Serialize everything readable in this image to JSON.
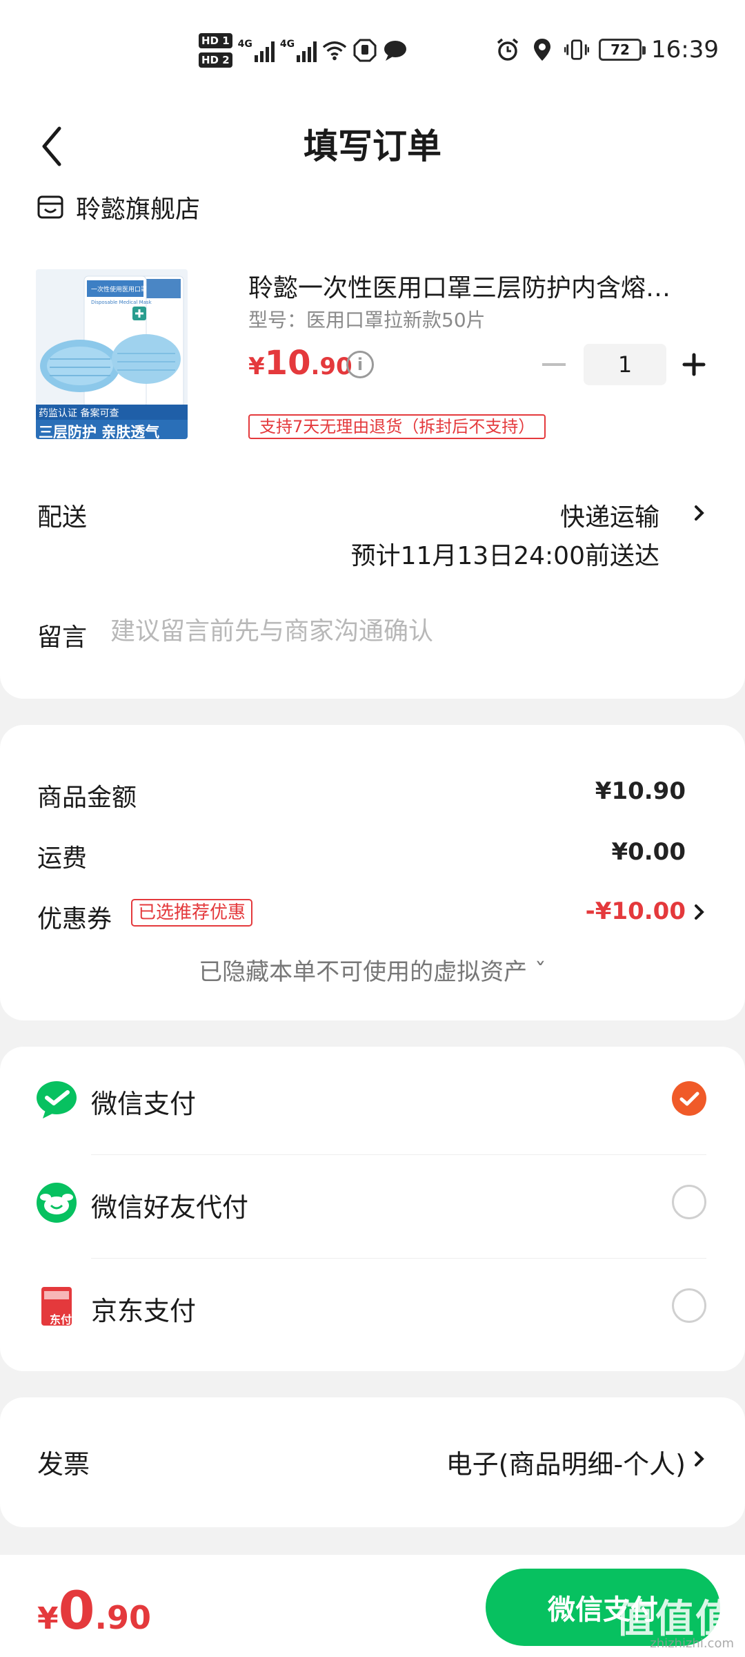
{
  "status_bar": {
    "hd1": "HD 1",
    "hd2": "HD 2",
    "net1": "4G",
    "net2": "4G",
    "battery": "72",
    "time": "16:39"
  },
  "header": {
    "title": "填写订单"
  },
  "shop": {
    "name": "聆懿旗舰店"
  },
  "product": {
    "name": "聆懿一次性医用口罩三层防护内含熔…",
    "model": "型号：医用口罩拉新款50片",
    "price_currency": "¥",
    "price_integer": "10",
    "price_decimal": ".90",
    "quantity": "1",
    "return_policy": "支持7天无理由退货（拆封后不支持）",
    "image_top_text": "一次性使用医用口罩",
    "image_sub_text": "Disposable Medical Mask",
    "image_cert_text": "药监认证 备案可查",
    "image_bottom_text": "三层防护 亲肤透气"
  },
  "delivery": {
    "label": "配送",
    "method": "快递运输",
    "estimate": "预计11月13日24:00前送达"
  },
  "message": {
    "label": "留言",
    "placeholder": "建议留言前先与商家沟通确认"
  },
  "summary": {
    "goods_label": "商品金额",
    "goods_value": "¥10.90",
    "shipping_label": "运费",
    "shipping_value": "¥0.00",
    "coupon_label": "优惠券",
    "coupon_badge": "已选推荐优惠",
    "coupon_value": "-¥10.00",
    "hidden_assets": "已隐藏本单不可使用的虚拟资产 ˇ"
  },
  "payment": {
    "methods": [
      {
        "label": "微信支付",
        "selected": true
      },
      {
        "label": "微信好友代付",
        "selected": false
      },
      {
        "label": "京东支付",
        "selected": false
      }
    ],
    "jd_icon_text": "东付"
  },
  "invoice": {
    "label": "发票",
    "value": "电子(商品明细-个人)"
  },
  "footer": {
    "total_currency": "¥",
    "total_integer": "0",
    "total_decimal": ".90",
    "pay_button": "微信支付",
    "watermark": "值值值",
    "watermark_url": "zhizhizhi.com"
  },
  "colors": {
    "accent_red": "#e4393c",
    "wechat_green": "#07c160",
    "check_orange": "#f05a28"
  }
}
